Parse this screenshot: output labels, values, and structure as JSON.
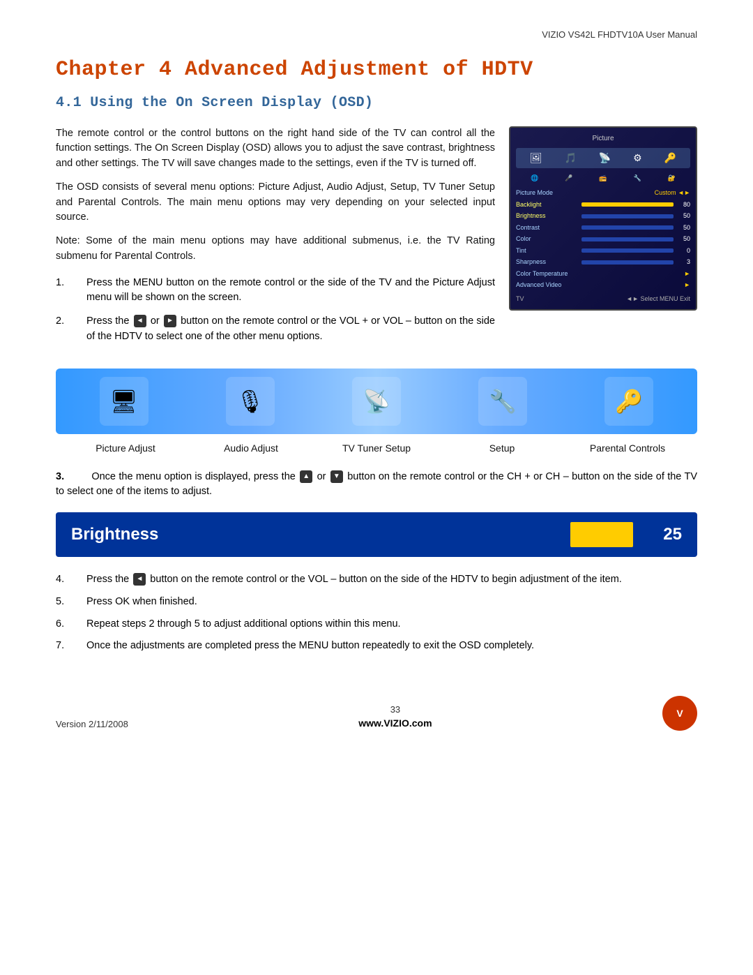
{
  "header": {
    "title": "VIZIO VS42L FHDTV10A User Manual"
  },
  "chapter": {
    "title": "Chapter 4 Advanced Adjustment of HDTV",
    "section": "4.1 Using the On Screen Display (OSD)"
  },
  "intro": {
    "para1": "The remote control or the control buttons on the right hand side of the TV can control all the function settings.  The On Screen Display (OSD) allows you to adjust the save contrast, brightness and other settings.  The TV will save changes made to the settings, even if the TV is turned off.",
    "para2": "The OSD consists of several menu options: Picture Adjust, Audio Adjust, Setup, TV Tuner Setup and Parental Controls.  The main menu options may very depending on your selected input source.",
    "note": "Note:  Some of the main menu options may have additional submenus, i.e. the TV Rating submenu for Parental Controls."
  },
  "osd": {
    "title": "Picture",
    "mode_label": "Picture Mode",
    "mode_value": "Custom",
    "rows": [
      {
        "label": "Backlight",
        "value": "80",
        "highlight": true
      },
      {
        "label": "Brightness",
        "value": "50",
        "highlight": true
      },
      {
        "label": "Contrast",
        "value": "50"
      },
      {
        "label": "Color",
        "value": "50"
      },
      {
        "label": "Tint",
        "value": "0"
      },
      {
        "label": "Sharpness",
        "value": "3"
      },
      {
        "label": "Color Temperature",
        "value": ""
      },
      {
        "label": "Advanced Video",
        "value": ""
      }
    ],
    "footer_left": "TV",
    "footer_right": "◄► Select  MENU Exit"
  },
  "steps": [
    {
      "num": "1.",
      "text": "Press the MENU button on the remote control or the side of the TV and the Picture Adjust menu will be shown on the screen."
    },
    {
      "num": "2.",
      "text": "Press the  or  button on the remote control or the VOL + or VOL – button on the side of the HDTV to select one of the other menu options."
    }
  ],
  "menu_items": [
    {
      "label": "Picture Adjust",
      "icon": "🖥"
    },
    {
      "label": "Audio Adjust",
      "icon": "🎙"
    },
    {
      "label": "TV Tuner Setup",
      "icon": "📡"
    },
    {
      "label": "Setup",
      "icon": "🔧"
    },
    {
      "label": "Parental Controls",
      "icon": "🔑"
    }
  ],
  "step3": {
    "num": "3.",
    "text": "Once the menu option is displayed, press the  or  button on the remote control or the CH + or CH – button on the side of the TV to select one of the items to adjust."
  },
  "brightness_bar": {
    "label": "Brightness",
    "value": "25"
  },
  "steps_bottom": [
    {
      "num": "4.",
      "text": "Press the  button on the remote control or the VOL – button on the side of the HDTV to begin adjustment of the item."
    },
    {
      "num": "5.",
      "text": "Press OK when finished."
    },
    {
      "num": "6.",
      "text": "Repeat steps 2 through 5 to adjust additional options within this menu."
    },
    {
      "num": "7.",
      "text": "Once the adjustments are completed press the MENU button repeatedly to exit the OSD completely."
    }
  ],
  "footer": {
    "version": "Version 2/11/2008",
    "page": "33",
    "website": "www.VIZIO.com",
    "logo": "V"
  }
}
